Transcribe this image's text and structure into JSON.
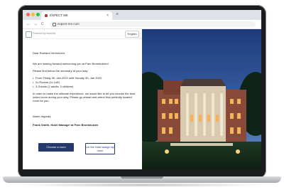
{
  "browser": {
    "tab_title": "EXPECT ME",
    "tab_close": "×",
    "new_tab": "+",
    "url": "expect-me.com",
    "nav_back": "←",
    "nav_forward": "→",
    "nav_reload": "C"
  },
  "page": {
    "powered_by": "Powered by expectly",
    "language": "English",
    "greeting": "Dear Roeland Verhoeven,",
    "intro": "We are looking forward welcoming you at Parc Broekhuizen!",
    "summary_intro": "Please find below the summary of your stay:",
    "stay_details": [
      "From Friday 30, Jan 2022 until Sunday 30, Jan 2022",
      "2x Rooms (1x Loft)",
      "3 Guests (2 adults, 0 children)"
    ],
    "body": "In order to make the ultimate experience, we would like to let you choose the best suited room during your stay. Please go ahead and select that perfectly located room for you.",
    "signoff": "Warm regards,",
    "signature": "Frank Smith, Hotel Manager at Parc Broekhuizen",
    "choose_room_button": "Choose a room",
    "hotel_assign_button": "Let the Hotel assign my room"
  },
  "colors": {
    "primary_button": "#26396b",
    "tab_bar": "#dee1e6",
    "laptop_bezel": "#1b1c1f"
  }
}
